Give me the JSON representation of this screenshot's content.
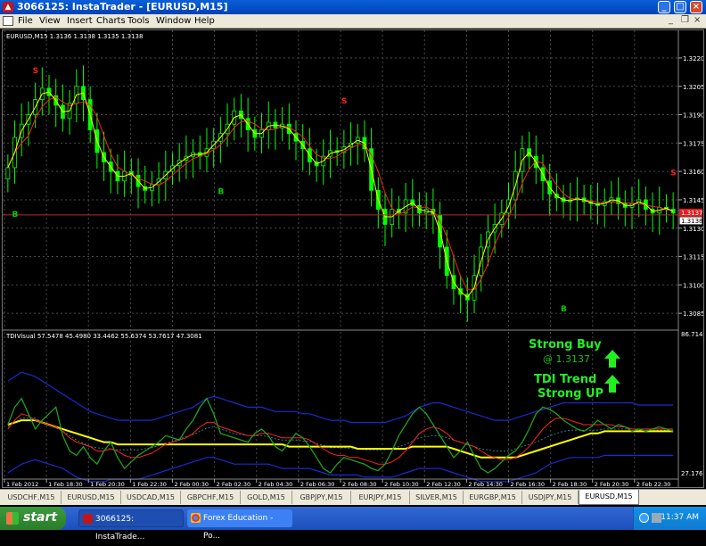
{
  "window": {
    "title": "3066125: InstaTrader - [EURUSD,M15]",
    "app_icon": "instatrader-icon",
    "minimize": "_",
    "maximize": "□",
    "close": "×"
  },
  "menu": {
    "items": [
      "File",
      "View",
      "Insert",
      "Charts",
      "Tools",
      "Window",
      "Help"
    ],
    "mdi_min": "_",
    "mdi_restore": "❐",
    "mdi_close": "×"
  },
  "main_chart": {
    "header": "EURUSD,M15  1.3136 1.3138 1.3135 1.3138",
    "price_ticks": [
      "1.3220",
      "1.3205",
      "1.3190",
      "1.3175",
      "1.3160",
      "1.3145",
      "1.3130",
      "1.3115",
      "1.3100",
      "1.3085"
    ],
    "bid_label": "1.3138",
    "ask_label": "1.3137",
    "signals": [
      {
        "text": "S",
        "type": "sell"
      },
      {
        "text": "S",
        "type": "sell"
      },
      {
        "text": "S",
        "type": "sell"
      },
      {
        "text": "B",
        "type": "buy"
      },
      {
        "text": "B",
        "type": "buy"
      },
      {
        "text": "B",
        "type": "buy"
      }
    ]
  },
  "indicator": {
    "header": "TDIVisual 57.5478 45.4980 33.4462 55.6374 53.7617 47.3081",
    "top_value": "86.714",
    "bottom_value": "27.1766",
    "strong_buy": "Strong Buy",
    "at_price": "@ 1.3137",
    "trend_line1": "TDI Trend",
    "trend_line2": "Strong UP"
  },
  "time_axis": [
    "1 Feb 2012",
    "1 Feb 18:30",
    "1 Feb 20:30",
    "1 Feb 22:30",
    "2 Feb 00:30",
    "2 Feb 02:30",
    "2 Feb 04:30",
    "2 Feb 06:30",
    "2 Feb 08:30",
    "2 Feb 10:30",
    "2 Feb 12:30",
    "2 Feb 14:30",
    "2 Feb 16:30",
    "2 Feb 18:30",
    "2 Feb 20:30",
    "2 Feb 22:30"
  ],
  "tabs": [
    "USDCHF,M15",
    "EURUSD,M15",
    "USDCAD,M15",
    "GBPCHF,M15",
    "GOLD,M15",
    "GBPJPY,M15",
    "EURJPY,M15",
    "SILVER,M15",
    "EURGBP,M15",
    "USDJPY,M15",
    "EURUSD,M15"
  ],
  "active_tab_index": 10,
  "taskbar": {
    "start": "start",
    "items": [
      "3066125: InstaTrade...",
      "Forex Education - Po..."
    ],
    "clock": "11:37 AM"
  },
  "colors": {
    "bull": "#00ff00",
    "bear": "#00ff00",
    "ma_red": "#ff2020",
    "ma_yellow": "#ffff00",
    "signal_sell": "#ff2020",
    "signal_buy": "#00cc00",
    "grid": "#4a4a4a",
    "band_blue": "#1a2ad0",
    "text_green": "#22ee22"
  },
  "chart_data": {
    "type": "candlestick",
    "y_range": [
      1.3078,
      1.3228
    ],
    "close": [
      1.3162,
      1.3178,
      1.3185,
      1.319,
      1.3198,
      1.3204,
      1.32,
      1.3195,
      1.3188,
      1.3196,
      1.3205,
      1.3198,
      1.3182,
      1.317,
      1.3165,
      1.316,
      1.3155,
      1.316,
      1.3158,
      1.3152,
      1.315,
      1.3153,
      1.3156,
      1.316,
      1.3163,
      1.3166,
      1.3168,
      1.317,
      1.3168,
      1.3172,
      1.3176,
      1.318,
      1.3185,
      1.3192,
      1.3188,
      1.3182,
      1.3178,
      1.3182,
      1.3186,
      1.3183,
      1.3185,
      1.318,
      1.3176,
      1.3172,
      1.3165,
      1.3163,
      1.3168,
      1.3171,
      1.317,
      1.3173,
      1.3175,
      1.3178,
      1.3172,
      1.315,
      1.314,
      1.3132,
      1.314,
      1.3138,
      1.3145,
      1.3142,
      1.3138,
      1.314,
      1.3137,
      1.312,
      1.3105,
      1.3098,
      1.3095,
      1.3092,
      1.3105,
      1.312,
      1.3128,
      1.3132,
      1.3138,
      1.3145,
      1.316,
      1.3172,
      1.3168,
      1.3162,
      1.3155,
      1.3148,
      1.3146,
      1.3144,
      1.3145,
      1.3146,
      1.3144,
      1.3143,
      1.3142,
      1.3144,
      1.3146,
      1.3143,
      1.3141,
      1.3143,
      1.3145,
      1.314,
      1.3138,
      1.3141,
      1.314,
      1.3138
    ],
    "tdi_green": [
      50,
      58,
      62,
      55,
      48,
      52,
      55,
      58,
      45,
      38,
      36,
      40,
      35,
      32,
      38,
      42,
      35,
      30,
      33,
      36,
      38,
      40,
      42,
      45,
      44,
      43,
      48,
      52,
      58,
      62,
      55,
      46,
      45,
      44,
      43,
      42,
      46,
      48,
      45,
      40,
      38,
      42,
      46,
      44,
      40,
      35,
      30,
      28,
      32,
      35,
      34,
      33,
      32,
      30,
      29,
      32,
      38,
      45,
      50,
      55,
      58,
      55,
      50,
      45,
      40,
      35,
      38,
      42,
      36,
      30,
      28,
      30,
      33,
      36,
      38,
      42,
      48,
      55,
      58,
      57,
      55,
      52,
      50,
      48,
      47,
      49,
      52,
      50,
      48,
      50,
      49,
      47,
      48,
      47,
      48,
      49,
      48,
      47
    ],
    "tdi_red": [
      48,
      52,
      55,
      54,
      52,
      51,
      50,
      49,
      47,
      44,
      42,
      41,
      40,
      38,
      38,
      39,
      38,
      36,
      35,
      35,
      36,
      37,
      39,
      41,
      42,
      43,
      44,
      46,
      49,
      51,
      51,
      49,
      48,
      47,
      46,
      45,
      45,
      46,
      46,
      45,
      44,
      44,
      44,
      44,
      43,
      41,
      39,
      37,
      36,
      36,
      35,
      35,
      34,
      33,
      32,
      32,
      33,
      35,
      38,
      42,
      46,
      48,
      49,
      48,
      46,
      43,
      42,
      41,
      40,
      38,
      36,
      35,
      34,
      34,
      35,
      37,
      40,
      44,
      48,
      51,
      53,
      53,
      52,
      51,
      50,
      50,
      50,
      50,
      50,
      49,
      49,
      48,
      48,
      48,
      48,
      48,
      48,
      48
    ],
    "tdi_yellow": [
      50,
      51,
      52,
      52,
      52,
      51,
      50,
      49,
      48,
      47,
      46,
      45,
      44,
      43,
      42,
      42,
      41,
      41,
      41,
      41,
      41,
      41,
      41,
      41,
      41,
      41,
      41,
      41,
      41,
      41,
      41,
      41,
      41,
      41,
      41,
      41,
      41,
      41,
      41,
      41,
      41,
      40,
      40,
      40,
      40,
      40,
      40,
      40,
      40,
      40,
      40,
      39,
      39,
      39,
      39,
      39,
      39,
      39,
      39,
      40,
      40,
      40,
      40,
      40,
      40,
      39,
      38,
      37,
      36,
      35,
      35,
      35,
      35,
      35,
      35,
      36,
      37,
      38,
      39,
      40,
      41,
      42,
      43,
      44,
      45,
      46,
      46,
      47,
      47,
      47,
      47,
      47,
      47,
      47,
      47,
      47,
      47,
      47
    ],
    "tdi_upper_band": [
      70,
      72,
      74,
      73,
      72,
      70,
      68,
      66,
      64,
      62,
      60,
      58,
      56,
      55,
      54,
      53,
      52,
      52,
      52,
      52,
      52,
      52,
      53,
      54,
      55,
      56,
      57,
      58,
      60,
      62,
      63,
      62,
      61,
      60,
      59,
      58,
      58,
      58,
      57,
      56,
      56,
      56,
      56,
      55,
      55,
      54,
      53,
      52,
      52,
      52,
      51,
      51,
      51,
      51,
      51,
      51,
      52,
      53,
      54,
      56,
      58,
      59,
      60,
      60,
      59,
      58,
      57,
      56,
      55,
      54,
      53,
      52,
      52,
      52,
      53,
      54,
      55,
      56,
      57,
      58,
      59,
      60,
      60,
      60,
      60,
      60,
      60,
      60,
      60,
      60,
      60,
      60,
      59,
      59,
      59,
      59,
      59,
      59
    ],
    "tdi_lower_band": [
      28,
      30,
      32,
      33,
      34,
      33,
      32,
      31,
      30,
      28,
      26,
      25,
      24,
      24,
      24,
      25,
      25,
      25,
      25,
      25,
      26,
      27,
      28,
      29,
      30,
      31,
      32,
      33,
      34,
      35,
      35,
      34,
      33,
      32,
      32,
      32,
      32,
      32,
      32,
      31,
      30,
      30,
      30,
      30,
      30,
      29,
      28,
      27,
      27,
      27,
      27,
      27,
      26,
      26,
      26,
      26,
      26,
      27,
      28,
      29,
      30,
      30,
      30,
      30,
      29,
      28,
      27,
      26,
      25,
      24,
      24,
      24,
      24,
      24,
      25,
      26,
      27,
      28,
      30,
      32,
      33,
      34,
      35,
      35,
      35,
      35,
      35,
      36,
      36,
      36,
      36,
      36,
      36,
      36,
      36,
      36,
      36,
      36
    ]
  }
}
